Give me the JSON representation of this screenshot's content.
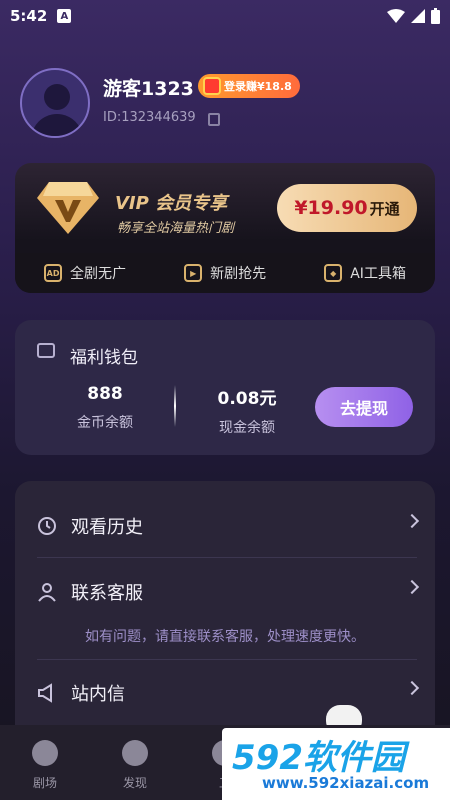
{
  "status": {
    "time": "5:42",
    "indicator": "A"
  },
  "profile": {
    "username": "游客1323",
    "badge": "登录赚¥18.8",
    "uid": "ID:132344639"
  },
  "vip": {
    "title": "VIP 会员专享",
    "subtitle": "畅享全站海量热门剧",
    "price": "¥19.90",
    "open": "开通",
    "features": [
      {
        "icon": "AD",
        "label": "全剧无广"
      },
      {
        "icon": "▶",
        "label": "新剧抢先"
      },
      {
        "icon": "◆",
        "label": "AI工具箱"
      }
    ]
  },
  "wallet": {
    "title": "福利钱包",
    "coins_value": "888",
    "coins_label": "金币余额",
    "cash_value": "0.08元",
    "cash_label": "现金余额",
    "withdraw": "去提现"
  },
  "menu": {
    "history": "观看历史",
    "service": "联系客服",
    "service_hint": "如有问题，请直接联系客服，处理速度更快。",
    "inbox": "站内信"
  },
  "tabs": [
    {
      "label": "剧场"
    },
    {
      "label": "发现"
    },
    {
      "label": "工"
    }
  ],
  "watermark": {
    "brand": "592软件园",
    "url": "www.592xiazai.com"
  },
  "colors": {
    "accent": "#8f62e6",
    "gold": "#e6b677"
  }
}
